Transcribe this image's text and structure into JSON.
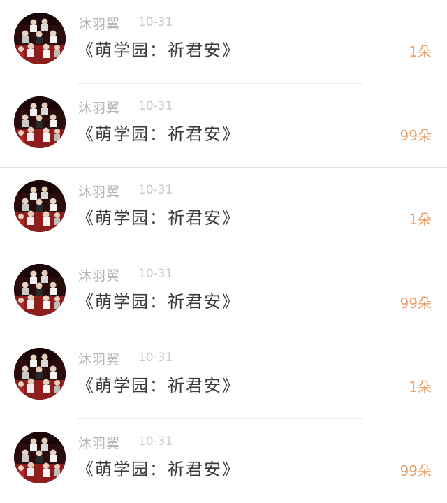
{
  "comments": [
    {
      "username": "沐羽翼",
      "date": "10-31",
      "message": "《萌学园：祈君安》",
      "gift": "1朵"
    },
    {
      "username": "沐羽翼",
      "date": "10-31",
      "message": "《萌学园：祈君安》",
      "gift": "99朵"
    },
    {
      "username": "沐羽翼",
      "date": "10-31",
      "message": "《萌学园：祈君安》",
      "gift": "1朵"
    },
    {
      "username": "沐羽翼",
      "date": "10-31",
      "message": "《萌学园：祈君安》",
      "gift": "99朵"
    },
    {
      "username": "沐羽翼",
      "date": "10-31",
      "message": "《萌学园：祈君安》",
      "gift": "1朵"
    },
    {
      "username": "沐羽翼",
      "date": "10-31",
      "message": "《萌学园：祈君安》",
      "gift": "99朵"
    }
  ],
  "colors": {
    "username": "#b5b5b5",
    "date": "#c8c8c8",
    "message": "#3a3a3a",
    "gift": "#e8a06a"
  }
}
